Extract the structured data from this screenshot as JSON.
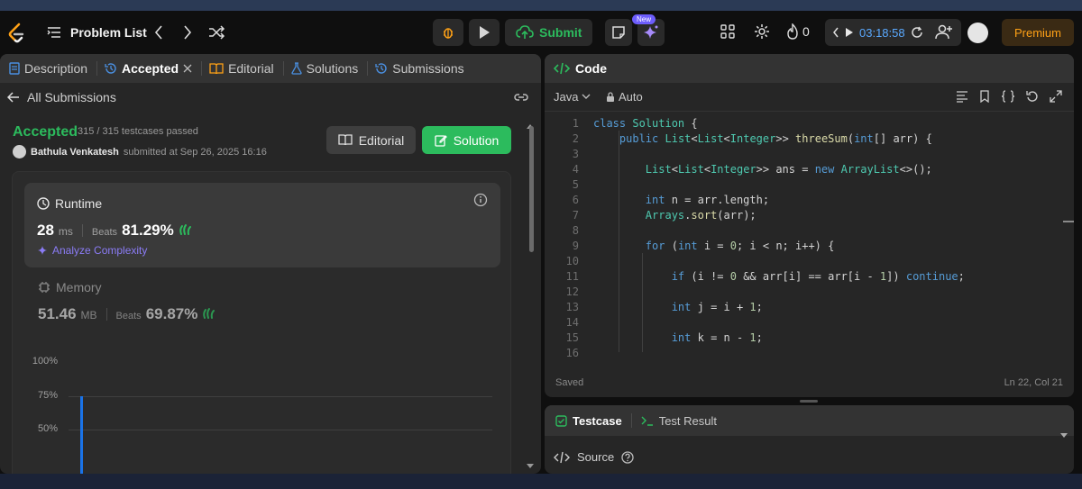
{
  "topbar": {
    "problem_list": "Problem List",
    "submit_label": "Submit",
    "new_badge": "New",
    "streak_count": "0",
    "timer": "03:18:58",
    "premium_label": "Premium"
  },
  "left_tabs": [
    {
      "label": "Description"
    },
    {
      "label": "Accepted"
    },
    {
      "label": "Editorial"
    },
    {
      "label": "Solutions"
    },
    {
      "label": "Submissions"
    }
  ],
  "submission": {
    "back_label": "All Submissions",
    "status": "Accepted",
    "testcases": "315 / 315 testcases passed",
    "author": "Bathula Venkatesh",
    "submitted_at": "submitted at Sep 26, 2025 16:16",
    "editorial_btn": "Editorial",
    "solution_btn": "Solution"
  },
  "runtime": {
    "title": "Runtime",
    "value": "28",
    "unit": "ms",
    "beats_label": "Beats",
    "beats": "81.29%",
    "analyze": "Analyze Complexity"
  },
  "memory": {
    "title": "Memory",
    "value": "51.46",
    "unit": "MB",
    "beats_label": "Beats",
    "beats": "69.87%"
  },
  "chart_data": {
    "type": "bar",
    "ytick_labels": [
      "100%",
      "75%",
      "50%"
    ],
    "ylim": [
      0,
      100
    ],
    "highlight_bar_value": 75
  },
  "code": {
    "header": "Code",
    "language": "Java",
    "auto": "Auto",
    "status": "Saved",
    "cursor": "Ln 22, Col 21",
    "lines": [
      {
        "n": "1",
        "text": "class Solution {"
      },
      {
        "n": "2",
        "text": "    public List<List<Integer>> threeSum(int[] arr) {"
      },
      {
        "n": "3",
        "text": ""
      },
      {
        "n": "4",
        "text": "        List<List<Integer>> ans = new ArrayList<>();"
      },
      {
        "n": "5",
        "text": ""
      },
      {
        "n": "6",
        "text": "        int n = arr.length;"
      },
      {
        "n": "7",
        "text": "        Arrays.sort(arr);"
      },
      {
        "n": "8",
        "text": ""
      },
      {
        "n": "9",
        "text": "        for (int i = 0; i < n; i++) {"
      },
      {
        "n": "10",
        "text": ""
      },
      {
        "n": "11",
        "text": "            if (i != 0 && arr[i] == arr[i - 1]) continue;"
      },
      {
        "n": "12",
        "text": ""
      },
      {
        "n": "13",
        "text": "            int j = i + 1;"
      },
      {
        "n": "14",
        "text": ""
      },
      {
        "n": "15",
        "text": "            int k = n - 1;"
      },
      {
        "n": "16",
        "text": ""
      }
    ]
  },
  "testpanel": {
    "testcase": "Testcase",
    "test_result": "Test Result",
    "source": "Source"
  },
  "colors": {
    "accent_green": "#2cbb5d",
    "accent_orange": "#ffa116",
    "link_purple": "#8b7cf6",
    "timer_blue": "#5aa9ff"
  }
}
